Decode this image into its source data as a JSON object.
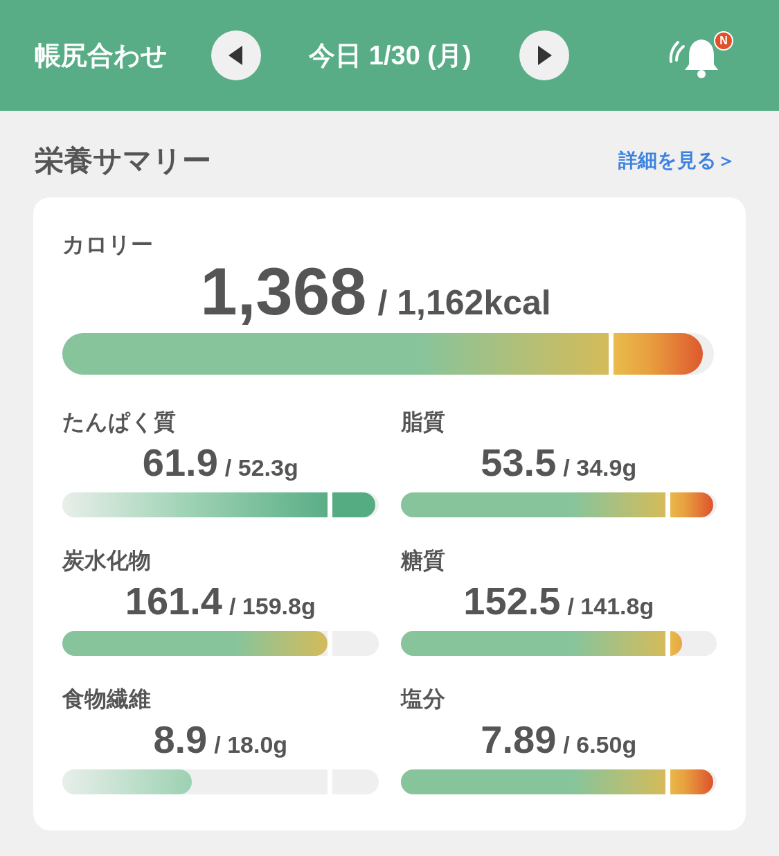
{
  "header": {
    "title": "帳尻合わせ",
    "date": "今日 1/30 (月)",
    "badge": "N"
  },
  "summary": {
    "title": "栄養サマリー",
    "link": "詳細を見る＞"
  },
  "calorie": {
    "label": "カロリー",
    "value": "1,368",
    "target": "/ 1,162kcal",
    "level": 0.983,
    "kind": "balance"
  },
  "nutrients": [
    {
      "label": "たんぱく質",
      "value": "61.9",
      "target": "/ 52.3g",
      "level": 0.99,
      "kind": "intake"
    },
    {
      "label": "脂質",
      "value": "53.5",
      "target": "/ 34.9g",
      "level": 0.99,
      "kind": "balance"
    },
    {
      "label": "炭水化物",
      "value": "161.4",
      "target": "/ 159.8g",
      "level": 0.838,
      "kind": "balance"
    },
    {
      "label": "糖質",
      "value": "152.5",
      "target": "/ 141.8g",
      "level": 0.89,
      "kind": "balance"
    },
    {
      "label": "食物繊維",
      "value": "8.9",
      "target": "/ 18.0g",
      "level": 0.41,
      "kind": "intake"
    },
    {
      "label": "塩分",
      "value": "7.89",
      "target": "/ 6.50g",
      "level": 0.99,
      "kind": "balance"
    }
  ]
}
